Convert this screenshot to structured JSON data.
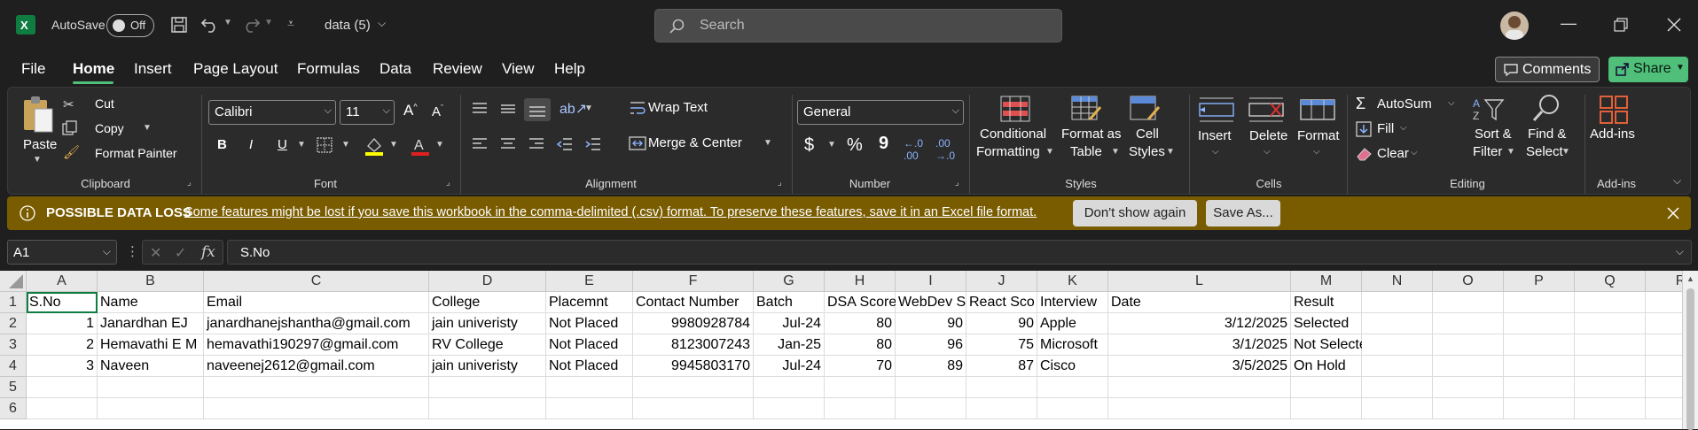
{
  "titlebar": {
    "autosave_label": "AutoSave",
    "autosave_state": "Off",
    "file_name": "data (5)",
    "search_placeholder": "Search"
  },
  "menu": {
    "items": [
      "File",
      "Home",
      "Insert",
      "Page Layout",
      "Formulas",
      "Data",
      "Review",
      "View",
      "Help"
    ],
    "comments_label": "Comments",
    "share_label": "Share"
  },
  "ribbon": {
    "clipboard": {
      "paste": "Paste",
      "cut": "Cut",
      "copy": "Copy",
      "format_painter": "Format Painter",
      "label": "Clipboard"
    },
    "font": {
      "family": "Calibri",
      "size": "11",
      "label": "Font",
      "bold": "B",
      "italic": "I",
      "underline": "U"
    },
    "alignment": {
      "wrap": "Wrap Text",
      "merge": "Merge & Center",
      "label": "Alignment"
    },
    "number": {
      "format": "General",
      "currency": "$",
      "percent": "%",
      "comma": "9",
      "label": "Number"
    },
    "styles": {
      "conditional_1": "Conditional",
      "conditional_2": "Formatting",
      "format_table_1": "Format as",
      "format_table_2": "Table",
      "cell_styles_1": "Cell",
      "cell_styles_2": "Styles",
      "label": "Styles"
    },
    "cells": {
      "insert": "Insert",
      "delete": "Delete",
      "format": "Format",
      "label": "Cells"
    },
    "editing": {
      "autosum": "AutoSum",
      "fill": "Fill",
      "clear": "Clear",
      "sort_1": "Sort &",
      "sort_2": "Filter",
      "find_1": "Find &",
      "find_2": "Select",
      "label": "Editing"
    },
    "addins": {
      "addins": "Add-ins",
      "label": "Add-ins"
    }
  },
  "warning": {
    "title": "POSSIBLE DATA LOSS",
    "message": "Some features might be lost if you save this workbook in the comma-delimited (.csv) format. To preserve these features, save it in an Excel file format.",
    "dont_show": "Don't show again",
    "save_as": "Save As..."
  },
  "formula_bar": {
    "name_box": "A1",
    "fx": "fx",
    "content": "S.No"
  },
  "sheet": {
    "columns": [
      "A",
      "B",
      "C",
      "D",
      "E",
      "F",
      "G",
      "H",
      "I",
      "J",
      "K",
      "L",
      "M",
      "N",
      "O",
      "P",
      "Q",
      "R"
    ],
    "row_numbers": [
      "1",
      "2",
      "3",
      "4",
      "5",
      "6"
    ],
    "header_row": [
      "S.No",
      "Name",
      "Email",
      "College",
      "Placemnt",
      "Contact Number",
      "Batch",
      "DSA Score",
      "WebDev S",
      "React Sco",
      "Interview",
      "Date",
      "Result"
    ],
    "rows": [
      [
        "1",
        "Janardhan EJ",
        "janardhanejshantha@gmail.com",
        "jain univeristy",
        "Not Placed",
        "9980928784",
        "Jul-24",
        "80",
        "90",
        "90",
        "Apple",
        "3/12/2025",
        "Selected"
      ],
      [
        "2",
        "Hemavathi E M",
        "hemavathi190297@gmail.com",
        "RV College",
        "Not Placed",
        "8123007243",
        "Jan-25",
        "80",
        "96",
        "75",
        "Microsoft",
        "3/1/2025",
        "Not Selected"
      ],
      [
        "3",
        "Naveen",
        "naveenej2612@gmail.com",
        "jain univeristy",
        "Not Placed",
        "9945803170",
        "Jul-24",
        "70",
        "89",
        "87",
        "Cisco",
        "3/5/2025",
        "On Hold"
      ]
    ]
  },
  "colors": {
    "excel_green": "#107c41",
    "warning": "#7a5c00",
    "share": "#4fbf7a"
  }
}
